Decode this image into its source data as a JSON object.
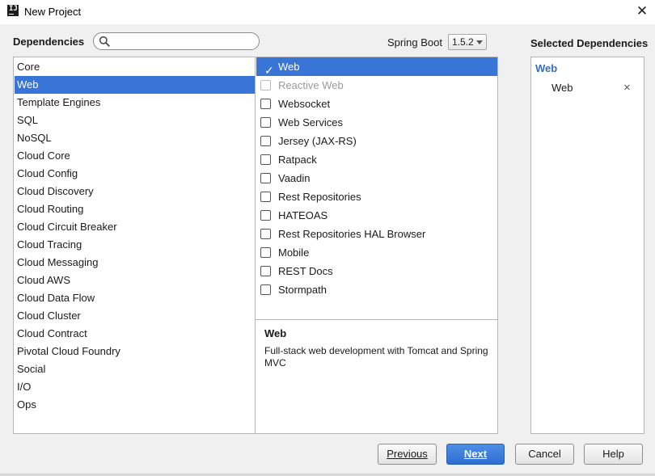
{
  "window": {
    "title": "New Project",
    "app_icon_text": "IJ",
    "close_glyph": "✕"
  },
  "toolbar": {
    "dependencies_label": "Dependencies",
    "search": {
      "value": "",
      "placeholder": ""
    },
    "spring_boot_label": "Spring Boot",
    "spring_boot_version": "1.5.2"
  },
  "categories": [
    {
      "label": "Core",
      "selected": false
    },
    {
      "label": "Web",
      "selected": true
    },
    {
      "label": "Template Engines",
      "selected": false
    },
    {
      "label": "SQL",
      "selected": false
    },
    {
      "label": "NoSQL",
      "selected": false
    },
    {
      "label": "Cloud Core",
      "selected": false
    },
    {
      "label": "Cloud Config",
      "selected": false
    },
    {
      "label": "Cloud Discovery",
      "selected": false
    },
    {
      "label": "Cloud Routing",
      "selected": false
    },
    {
      "label": "Cloud Circuit Breaker",
      "selected": false
    },
    {
      "label": "Cloud Tracing",
      "selected": false
    },
    {
      "label": "Cloud Messaging",
      "selected": false
    },
    {
      "label": "Cloud AWS",
      "selected": false
    },
    {
      "label": "Cloud Data Flow",
      "selected": false
    },
    {
      "label": "Cloud Cluster",
      "selected": false
    },
    {
      "label": "Cloud Contract",
      "selected": false
    },
    {
      "label": "Pivotal Cloud Foundry",
      "selected": false
    },
    {
      "label": "Social",
      "selected": false
    },
    {
      "label": "I/O",
      "selected": false
    },
    {
      "label": "Ops",
      "selected": false
    }
  ],
  "dependencies": [
    {
      "label": "Web",
      "checked": true,
      "disabled": false,
      "selected": true
    },
    {
      "label": "Reactive Web",
      "checked": false,
      "disabled": true,
      "selected": false
    },
    {
      "label": "Websocket",
      "checked": false,
      "disabled": false,
      "selected": false
    },
    {
      "label": "Web Services",
      "checked": false,
      "disabled": false,
      "selected": false
    },
    {
      "label": "Jersey (JAX-RS)",
      "checked": false,
      "disabled": false,
      "selected": false
    },
    {
      "label": "Ratpack",
      "checked": false,
      "disabled": false,
      "selected": false
    },
    {
      "label": "Vaadin",
      "checked": false,
      "disabled": false,
      "selected": false
    },
    {
      "label": "Rest Repositories",
      "checked": false,
      "disabled": false,
      "selected": false
    },
    {
      "label": "HATEOAS",
      "checked": false,
      "disabled": false,
      "selected": false
    },
    {
      "label": "Rest Repositories HAL Browser",
      "checked": false,
      "disabled": false,
      "selected": false
    },
    {
      "label": "Mobile",
      "checked": false,
      "disabled": false,
      "selected": false
    },
    {
      "label": "REST Docs",
      "checked": false,
      "disabled": false,
      "selected": false
    },
    {
      "label": "Stormpath",
      "checked": false,
      "disabled": false,
      "selected": false
    }
  ],
  "description": {
    "title": "Web",
    "text": "Full-stack web development with Tomcat and Spring MVC"
  },
  "selected_dependencies": {
    "header": "Selected Dependencies",
    "group": "Web",
    "items": [
      {
        "label": "Web",
        "remove_glyph": "×"
      }
    ]
  },
  "buttons": {
    "previous": "Previous",
    "next": "Next",
    "cancel": "Cancel",
    "help": "Help"
  },
  "colors": {
    "selection": "#3875d7",
    "group_label": "#3a6db8",
    "primary_button": "#2e6ed2"
  }
}
